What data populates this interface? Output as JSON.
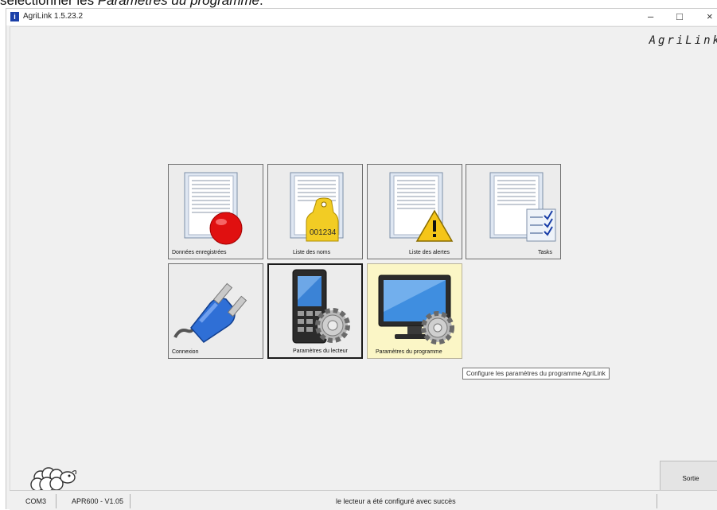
{
  "doc_caption": {
    "prefix": "sélectionner les ",
    "emph": "Paramètres du programme",
    "suffix": "."
  },
  "window": {
    "title": "AgriLink 1.5.23.2",
    "minimize": "–",
    "maximize": "□",
    "close": "×"
  },
  "brand": "AgriLink",
  "tiles": {
    "recorded": {
      "label": "Données enregistrées"
    },
    "names": {
      "label": "Liste des noms",
      "tag_number": "001234"
    },
    "alerts": {
      "label": "Liste des alertes"
    },
    "tasks": {
      "label": "Tasks"
    },
    "connection": {
      "label": "Connexion"
    },
    "reader_settings": {
      "label": "Paramètres du lecteur"
    },
    "program_settings": {
      "label": "Paramètres du programme"
    }
  },
  "tooltip": "Configure les paramètres du programme AgriLink",
  "exit_button": "Sortie",
  "statusbar": {
    "port": "COM3",
    "device": "APR600 - V1.05",
    "message": "le lecteur a été configuré avec succès"
  },
  "icons": [
    "app-icon",
    "document-icon",
    "record-dot-icon",
    "ear-tag-icon",
    "warning-icon",
    "checklist-icon",
    "plug-icon",
    "reader-device-icon",
    "gear-icon",
    "monitor-icon",
    "sheep-logo"
  ],
  "colors": {
    "window_bg": "#f0f0f0",
    "tile_bg": "#ececec",
    "hover_tile_bg": "#fbf6c6",
    "record_red": "#e01010",
    "tag_yellow": "#f2cc24",
    "warning_yellow": "#f5c518",
    "plug_blue": "#2f6fd6"
  }
}
